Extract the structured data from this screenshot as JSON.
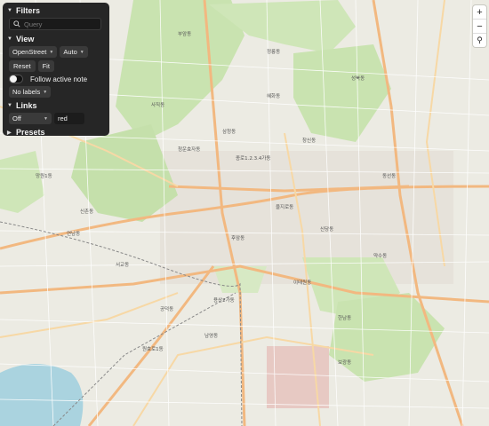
{
  "panel": {
    "filters": {
      "label": "Filters",
      "placeholder": "Query"
    },
    "view": {
      "label": "View",
      "tile_source": "OpenStreet",
      "mode": "Auto",
      "reset_label": "Reset",
      "fit_label": "Fit",
      "follow_label": "Follow active note",
      "labels_option": "No labels"
    },
    "links": {
      "label": "Links",
      "mode": "Off",
      "color_value": "red"
    },
    "presets": {
      "label": "Presets"
    }
  },
  "zoom": {
    "in": "+",
    "out": "−",
    "search": "⚲"
  },
  "map_labels": [
    "을지로동",
    "종로1.2.3.4가동",
    "이태원동",
    "한남동",
    "서교동",
    "성북동",
    "삼청동",
    "청운효자동",
    "신촌동",
    "공덕동",
    "용산2가동",
    "후암동",
    "동선동",
    "혜화동",
    "신당동",
    "약수동",
    "사직동",
    "망원1동",
    "연남동",
    "정릉동",
    "남영동",
    "보광동",
    "원효로1동",
    "창신동",
    "부암동"
  ],
  "colors": {
    "panel_bg": "#262626",
    "map_bg": "#ecebe3",
    "park": "#c9e3b0",
    "water": "#aad3df",
    "road_major": "#f5c995",
    "road_minor": "#ffffff"
  }
}
